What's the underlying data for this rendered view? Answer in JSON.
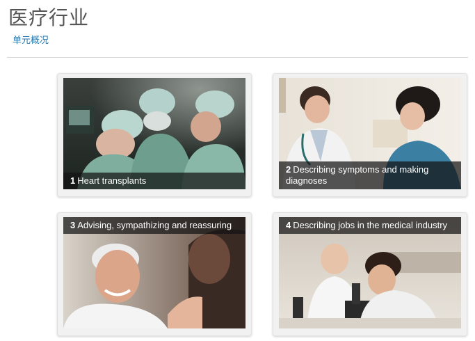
{
  "header": {
    "title": "医疗行业",
    "breadcrumb": "单元概况"
  },
  "units": [
    {
      "number": "1",
      "title": "Heart transplants",
      "image": "surgeons-operating-photo"
    },
    {
      "number": "2",
      "title": "Describing symptoms and making diagnoses",
      "image": "doctor-patient-consultation-photo"
    },
    {
      "number": "3",
      "title": "Advising, sympathizing and reassuring",
      "image": "elderly-patient-smiling-photo"
    },
    {
      "number": "4",
      "title": "Describing jobs in the medical industry",
      "image": "lab-microscope-photo"
    }
  ]
}
